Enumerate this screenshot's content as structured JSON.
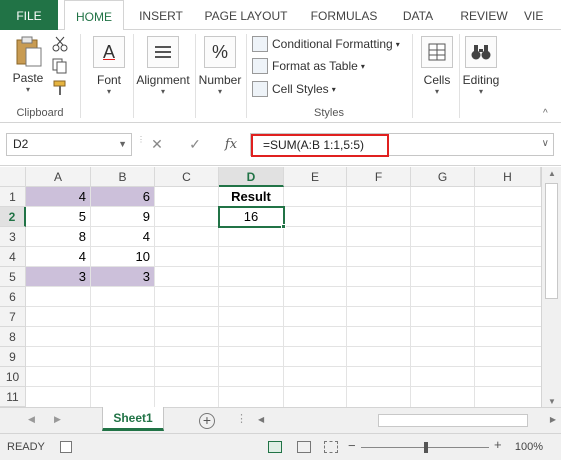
{
  "tabs": [
    "FILE",
    "HOME",
    "INSERT",
    "PAGE LAYOUT",
    "FORMULAS",
    "DATA",
    "REVIEW",
    "VIE"
  ],
  "ribbon": {
    "clipboard": {
      "paste": "Paste",
      "label": "Clipboard"
    },
    "font": "Font",
    "alignment": "Alignment",
    "number": "Number",
    "styles": {
      "conditional": "Conditional Formatting",
      "format_table": "Format as Table",
      "cell_styles": "Cell Styles",
      "label": "Styles"
    },
    "cells": "Cells",
    "editing": "Editing"
  },
  "formula_bar": {
    "name_box": "D2",
    "fx": "fx",
    "formula": "=SUM(A:B 1:1,5:5)"
  },
  "grid": {
    "columns": [
      "A",
      "B",
      "C",
      "D",
      "E",
      "F",
      "G",
      "H"
    ],
    "rows": [
      "1",
      "2",
      "3",
      "4",
      "5",
      "6",
      "7",
      "8",
      "9",
      "10",
      "11"
    ],
    "col_a": [
      "4",
      "5",
      "8",
      "4",
      "3"
    ],
    "col_b": [
      "6",
      "9",
      "4",
      "10",
      "3"
    ],
    "result_header": "Result",
    "result_value": "16"
  },
  "sheets": [
    "Sheet1"
  ],
  "status": {
    "ready": "READY",
    "zoom": "100%"
  }
}
